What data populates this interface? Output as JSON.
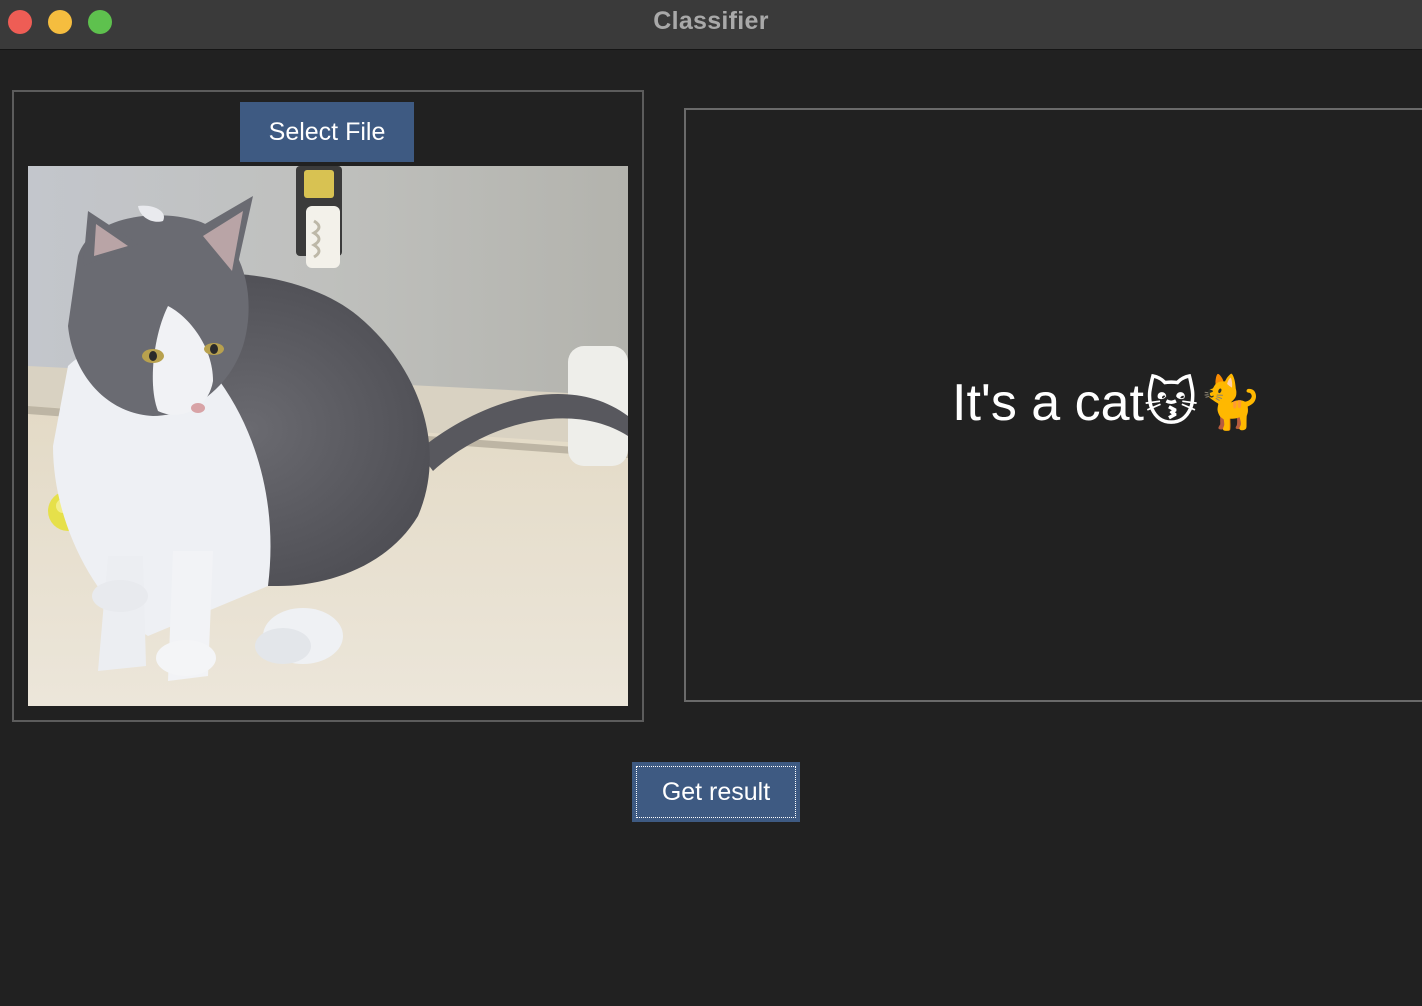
{
  "window": {
    "title": "Classifier"
  },
  "left_panel": {
    "select_button_label": "Select File",
    "image_alt": "cat photo"
  },
  "result_panel": {
    "result_text": "It's a cat😽🐈"
  },
  "actions": {
    "get_result_label": "Get result"
  },
  "colors": {
    "background": "#212121",
    "titlebar": "#3a3a3a",
    "button": "#3e5a82",
    "border": "#5c5c5c",
    "text": "#ffffff"
  }
}
